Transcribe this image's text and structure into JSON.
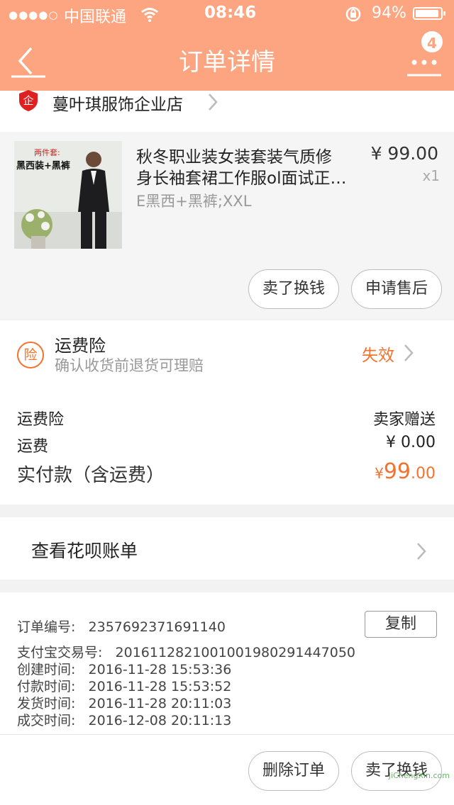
{
  "status_bar": {
    "signal": "●●●●○",
    "carrier": "中国联通",
    "wifi": "wifi-icon",
    "time": "08:46",
    "battery": "94%",
    "battery_level": 0.94
  },
  "nav": {
    "title": "订单详情",
    "badge": "4",
    "icons": [
      "back-arrow-icon",
      "more-dots-icon"
    ]
  },
  "shop": {
    "name": "蔓叶琪服饰企业店",
    "logo_text": "企"
  },
  "product": {
    "title_line1": "秋冬职业装女装套装气质修",
    "title_line2": "身长袖套裙工作服ol面试正…",
    "sku": "E黑西+黑裤;XXL",
    "price": "¥ 99.00",
    "qty": "x1",
    "image_caption_top": "两件套:",
    "image_caption_main": "黑西装+黑裤",
    "btn_sell": "卖了换钱",
    "btn_aftersale": "申请售后"
  },
  "insurance": {
    "icon_text": "险",
    "title": "运费险",
    "subtitle": "确认收货前退货可理赔",
    "status": "失效"
  },
  "summary": {
    "rows": [
      {
        "label": "运费险",
        "value": "卖家赠送"
      },
      {
        "label": "运费",
        "value": "¥ 0.00"
      }
    ],
    "paid_label": "实付款（含运费）",
    "paid_currency": "¥",
    "paid_int": "99",
    "paid_dec": ".00"
  },
  "huabei": {
    "label": "查看花呗账单"
  },
  "order_info": {
    "rows": [
      {
        "label": "订单编号:",
        "value": "2357692371691140"
      },
      {
        "label": "支付宝交易号:",
        "value": "2016112821001001980291447050"
      },
      {
        "label": "创建时间:",
        "value": "2016-11-28 15:53:36"
      },
      {
        "label": "付款时间:",
        "value": "2016-11-28 15:53:52"
      },
      {
        "label": "发货时间:",
        "value": "2016-11-28 20:11:03"
      },
      {
        "label": "成交时间:",
        "value": "2016-12-08 20:11:13"
      }
    ],
    "copy_label": "复制",
    "btn_delete": "删除订单",
    "btn_sell": "卖了换钱"
  },
  "watermark": {
    "text": "JiChengXin.com"
  },
  "colors": {
    "header": "#fca580",
    "accent": "#f5722d",
    "background": "#f2f2f2"
  }
}
